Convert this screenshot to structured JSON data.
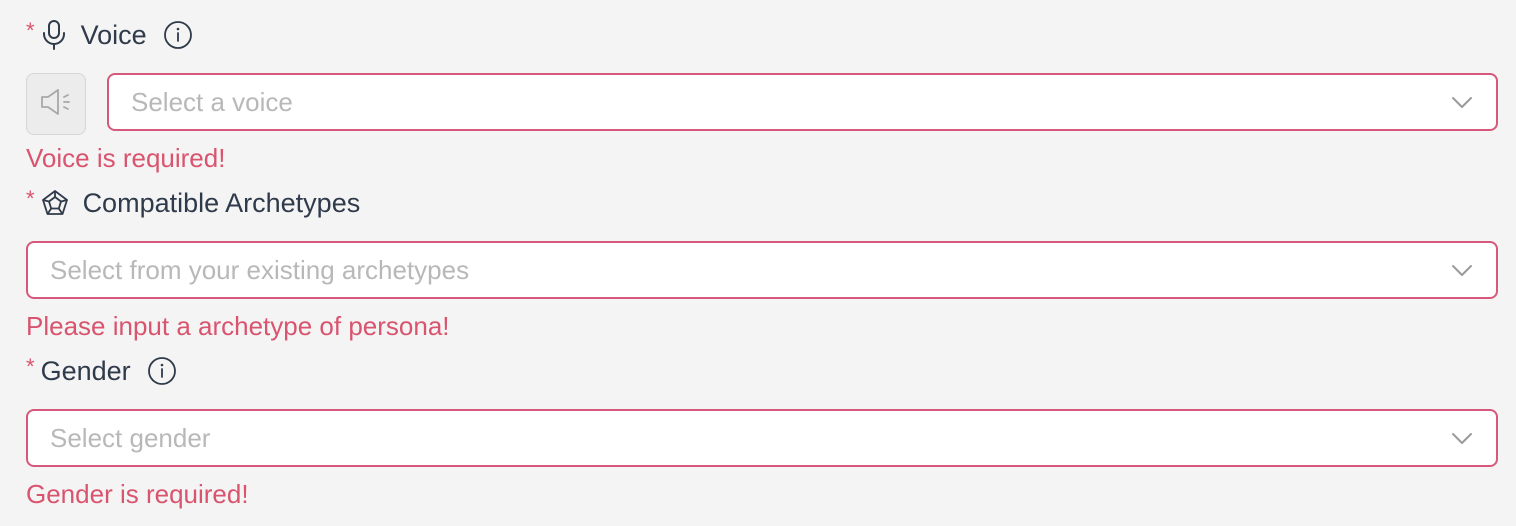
{
  "required_marker": "*",
  "voice": {
    "label": "Voice",
    "placeholder": "Select a voice",
    "error": "Voice is required!",
    "icon": "microphone-icon",
    "play_icon": "speaker-icon"
  },
  "archetypes": {
    "label": "Compatible Archetypes",
    "placeholder": "Select from your existing archetypes",
    "error": "Please input a archetype of persona!",
    "icon": "pentagon-web-icon"
  },
  "gender": {
    "label": "Gender",
    "placeholder": "Select gender",
    "error": "Gender is required!"
  },
  "colors": {
    "error": "#d9546e",
    "border_error": "#d6587a",
    "placeholder": "#b8b8b8",
    "label": "#2f3a4a",
    "background": "#f4f4f4"
  }
}
